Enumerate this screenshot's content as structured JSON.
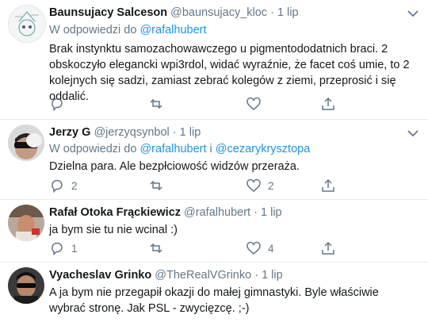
{
  "tweets": [
    {
      "name": "Baunsujacy Salceson",
      "handle": "@baunsujacy_kloc",
      "dot": "·",
      "date": "1 lip",
      "reply_prefix": "W odpowiedzi do",
      "reply_to_1": "@rafalhubert",
      "reply_join": "",
      "reply_to_2": "",
      "text": "Brak instynktu samozachowawczego u pigmentododatnich braci. 2 obskoczyło elegancki wpi3rdol, widać wyraźnie, że facet coś umie, to 2 kolejnych się sadzi, zamiast zebrać kolegów z ziemi, przeprosić i się oddalić.",
      "replies": "",
      "retweets": "",
      "likes": ""
    },
    {
      "name": "Jerzy G",
      "handle": "@jerzyqsynbol",
      "dot": "·",
      "date": "1 lip",
      "reply_prefix": "W odpowiedzi do",
      "reply_to_1": "@rafalhubert",
      "reply_join": "i",
      "reply_to_2": "@cezaryk­rysztopa",
      "text": "Dzielna para. Ale bezpłciowość widzów przeraża.",
      "replies": "2",
      "retweets": "",
      "likes": "2"
    },
    {
      "name": "Rafał Otoka Frąckiewicz",
      "handle": "@rafalhubert",
      "dot": "·",
      "date": "1 lip",
      "text": "ja bym sie tu nie wcinal :)",
      "replies": "1",
      "retweets": "",
      "likes": "4"
    },
    {
      "name": "Vyacheslav Grinko",
      "handle": "@TheRealVGrinko",
      "dot": "·",
      "date": "1 lip",
      "text": "A ja bym nie przegapił okazji do małej gimnastyki. Byle właściwie wybrać stronę. Jak PSL - zwycięzcę. ;-)"
    }
  ],
  "icons": {
    "reply": "reply-icon",
    "retweet": "retweet-icon",
    "like": "heart-icon",
    "share": "share-icon",
    "caret": "chevron-down-icon"
  },
  "colors": {
    "link": "#1b95e0",
    "muted": "#657786",
    "text": "#14171a",
    "separator": "#e6ecf0"
  }
}
